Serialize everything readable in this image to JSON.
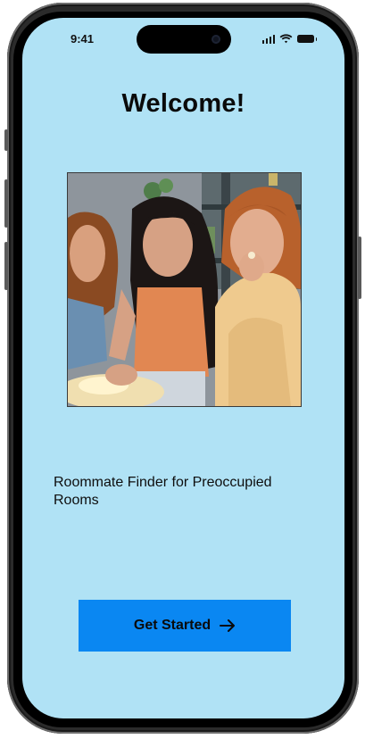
{
  "status_bar": {
    "time": "9:41",
    "icons": [
      "signal-icon",
      "wifi-icon",
      "battery-icon"
    ]
  },
  "welcome": {
    "title": "Welcome!",
    "image_subject": "three young women eating popcorn while watching something"
  },
  "tagline": "Roommate Finder for Preoccupied Rooms",
  "cta": {
    "label": "Get Started",
    "icon": "arrow-right-icon"
  },
  "colors": {
    "background": "#b0e2f5",
    "button": "#0a87f2",
    "text": "#0a0a0a"
  }
}
